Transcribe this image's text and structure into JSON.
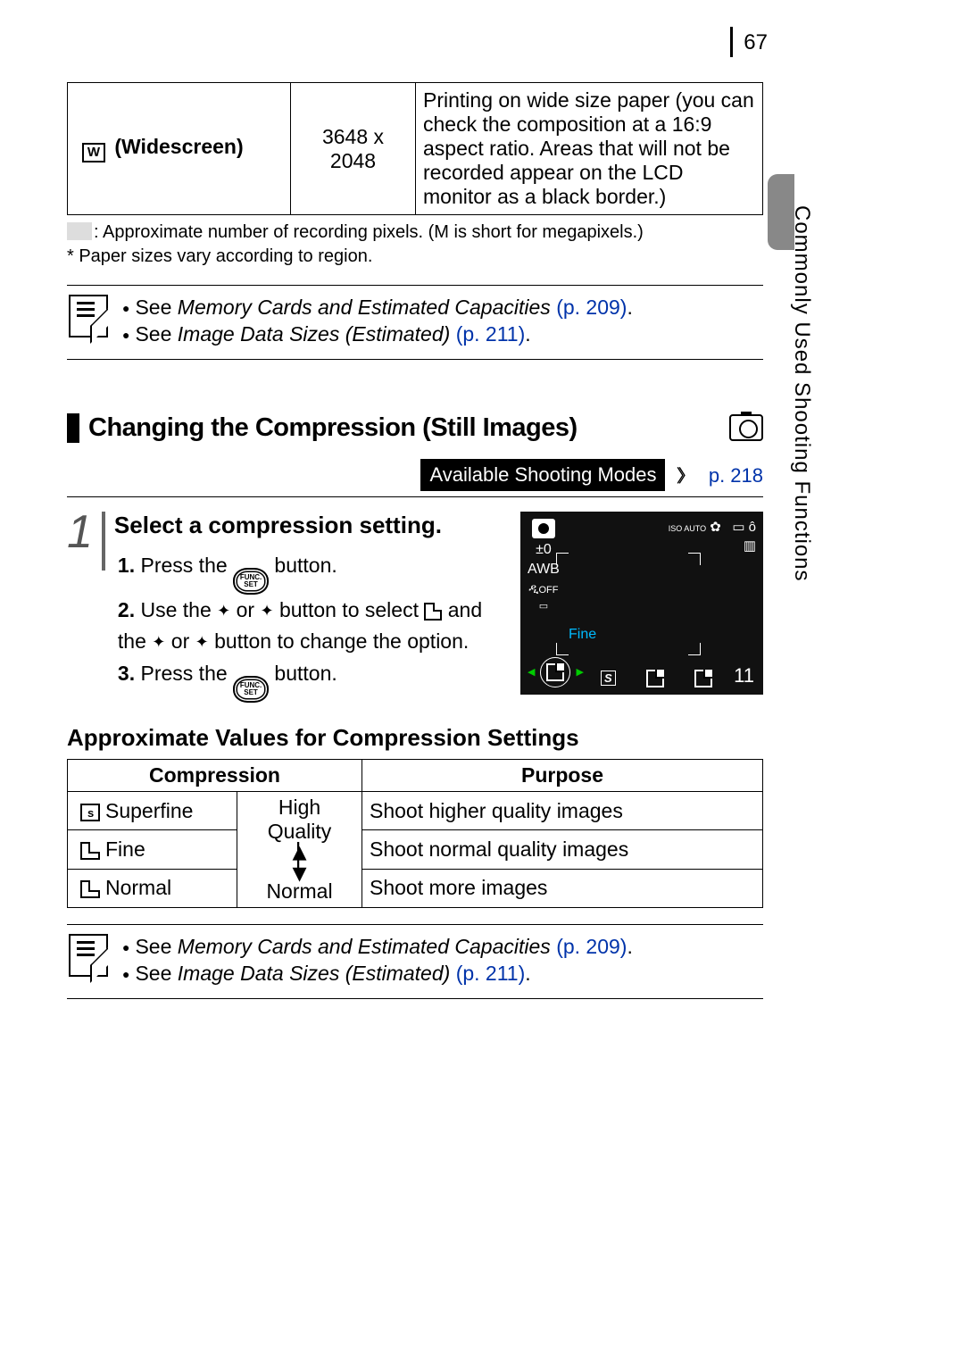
{
  "page_number": "67",
  "sidebar_label": "Commonly Used Shooting Functions",
  "table_widescreen": {
    "label": "(Widescreen)",
    "icon_letter": "W",
    "resolution": "3648 x 2048",
    "description": "Printing on wide size paper (you can check the composition at a 16:9 aspect ratio. Areas that will not be recorded appear on the LCD monitor as a black border.)"
  },
  "footnote1": ": Approximate number of recording pixels. (M is short for megapixels.)",
  "footnote2": "* Paper sizes vary according to region.",
  "notes": {
    "line1_prefix": "See ",
    "line1_ital": "Memory Cards and Estimated Capacities",
    "line1_suffix": " ",
    "line1_link": "(p. 209)",
    "line1_end": ".",
    "line2_prefix": "See ",
    "line2_ital": "Image Data Sizes (Estimated)",
    "line2_suffix": " ",
    "line2_link": "(p. 211)",
    "line2_end": "."
  },
  "heading": "Changing the Compression (Still Images)",
  "modes_label": "Available Shooting Modes",
  "modes_link": "p. 218",
  "step_number": "1",
  "step_title": "Select a compression setting.",
  "substep1_num": "1.",
  "substep1_a": "Press the ",
  "substep1_b": " button.",
  "substep2_num": "2.",
  "substep2_a": "Use the ",
  "substep2_b": " or ",
  "substep2_c": " button to select ",
  "substep2_d": " and the ",
  "substep2_e": " or ",
  "substep2_f": " button to change the option.",
  "substep3_num": "3.",
  "substep3_a": "Press the ",
  "substep3_b": " button.",
  "funcset_top": "FUNC.",
  "funcset_bot": "SET",
  "lcd": {
    "ev": "±0",
    "awb": "AWB",
    "off": "OFF",
    "iso": "ISO AUTO",
    "fine": "Fine",
    "shots": "11",
    "s_icon": "S"
  },
  "subheading": "Approximate Values for Compression Settings",
  "table2": {
    "h1": "Compression",
    "h2": "Purpose",
    "r1_name": "Superfine",
    "r1_purpose": "Shoot higher quality images",
    "r2_name": "Fine",
    "r2_purpose": "Shoot normal quality images",
    "r3_name": "Normal",
    "r3_purpose": "Shoot more images",
    "scale_top": "High Quality",
    "scale_bot": "Normal"
  }
}
